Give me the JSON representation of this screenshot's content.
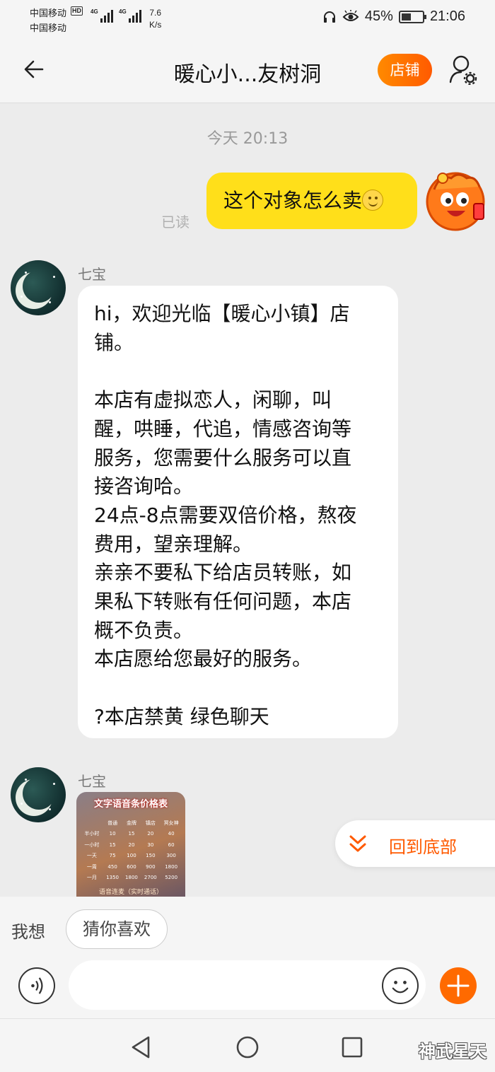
{
  "status_bar": {
    "carrier1": "中国移动",
    "carrier2": "中国移动",
    "hd_badge": "HD",
    "network1": "4G",
    "network2": "4G",
    "net_speed_value": "7.6",
    "net_speed_unit": "K/s",
    "battery_percent": "45%",
    "battery_level": 0.45,
    "time": "21:06",
    "icons": [
      "headset-icon",
      "eye-comfort-icon",
      "battery-icon"
    ]
  },
  "header": {
    "back_icon": "back-arrow-icon",
    "title": "暖心小...友树洞",
    "shop_button": "店铺",
    "profile_icon": "user-settings-icon"
  },
  "chat": {
    "timestamp": "今天  20:13",
    "outgoing": {
      "text": "这个对象怎么卖",
      "status": "已读"
    },
    "incoming": [
      {
        "sender": "七宝",
        "lines": [
          "hi，欢迎光临【暖心小镇】店",
          "铺。",
          "",
          "本店有虚拟恋人，闲聊，叫",
          "醒，哄睡，代追，情感咨询等",
          "服务，您需要什么服务可以直",
          "接咨询哈。",
          "24点-8点需要双倍价格，熬夜",
          "费用，望亲理解。",
          "亲亲不要私下给店员转账，如",
          "果私下转账有任何问题，本店",
          "概不负责。",
          "本店愿给您最好的服务。",
          "",
          "?本店禁黄 绿色聊天"
        ]
      },
      {
        "sender": "七宝",
        "image": {
          "title": "文字语音条价格表",
          "headers": [
            "",
            "普通",
            "金牌",
            "镇店",
            "冥女神"
          ],
          "rows": [
            [
              "半小时",
              "10",
              "15",
              "20",
              "40"
            ],
            [
              "一小时",
              "15",
              "20",
              "30",
              "60"
            ],
            [
              "一天",
              "75",
              "100",
              "150",
              "300"
            ],
            [
              "一周",
              "450",
              "600",
              "900",
              "1800"
            ],
            [
              "一月",
              "1350",
              "1800",
              "2700",
              "5200"
            ]
          ],
          "footer": "语音连麦（实时通话）"
        }
      }
    ],
    "back_to_bottom": "回到底部"
  },
  "suggestions": {
    "label": "我想",
    "chip": "猜你喜欢"
  },
  "input_bar": {
    "value": "",
    "placeholder": "",
    "voice_icon": "voice-icon",
    "emoji_icon": "emoji-icon",
    "plus_icon": "plus-icon"
  },
  "system_nav": {
    "buttons": [
      "back-triangle-icon",
      "home-circle-icon",
      "recent-square-icon"
    ],
    "watermark": "神武星天"
  },
  "colors": {
    "accent": "#ff5a00",
    "outgoing_bubble": "#ffdf1a",
    "background": "#ececec"
  }
}
